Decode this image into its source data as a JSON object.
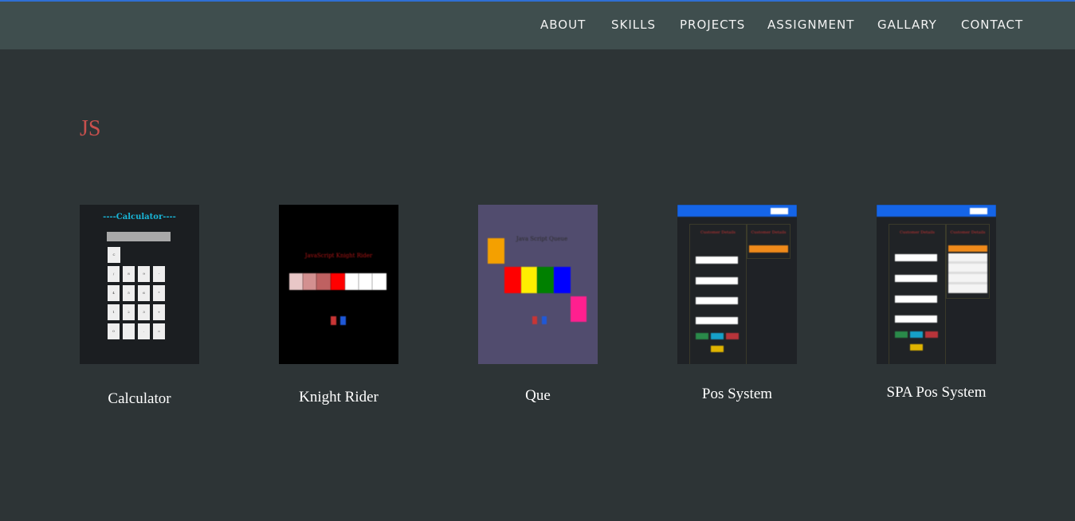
{
  "nav": {
    "items": [
      "ABOUT",
      "SKILLS",
      "PROJECTS",
      "ASSIGNMENT",
      "GALLARY",
      "CONTACT"
    ]
  },
  "section": {
    "title": "JS"
  },
  "projects": [
    {
      "name": "Calculator",
      "thumb_title": "----Calculator----",
      "keys": [
        "C",
        "/",
        "8",
        "9",
        "-",
        "4",
        "5",
        "6",
        "*",
        "1",
        "2",
        "3",
        "+",
        "0",
        "",
        ".",
        "="
      ]
    },
    {
      "name": "Knight Rider",
      "thumb_title": "JavaScript Knight Rider"
    },
    {
      "name": "Que",
      "thumb_title": "Java Script Queue"
    },
    {
      "name": "Pos System",
      "thumb_panel_left": "Customer Details",
      "thumb_panel_right": "Customer Details"
    },
    {
      "name": "SPA Pos System",
      "thumb_panel_left": "Customer Details",
      "thumb_panel_right": "Customer Details"
    }
  ],
  "colors": {
    "background": "#2d3436",
    "navbar": "#3f4e4e",
    "accent_line": "#2f6fd4",
    "section_title": "#c8504d"
  }
}
